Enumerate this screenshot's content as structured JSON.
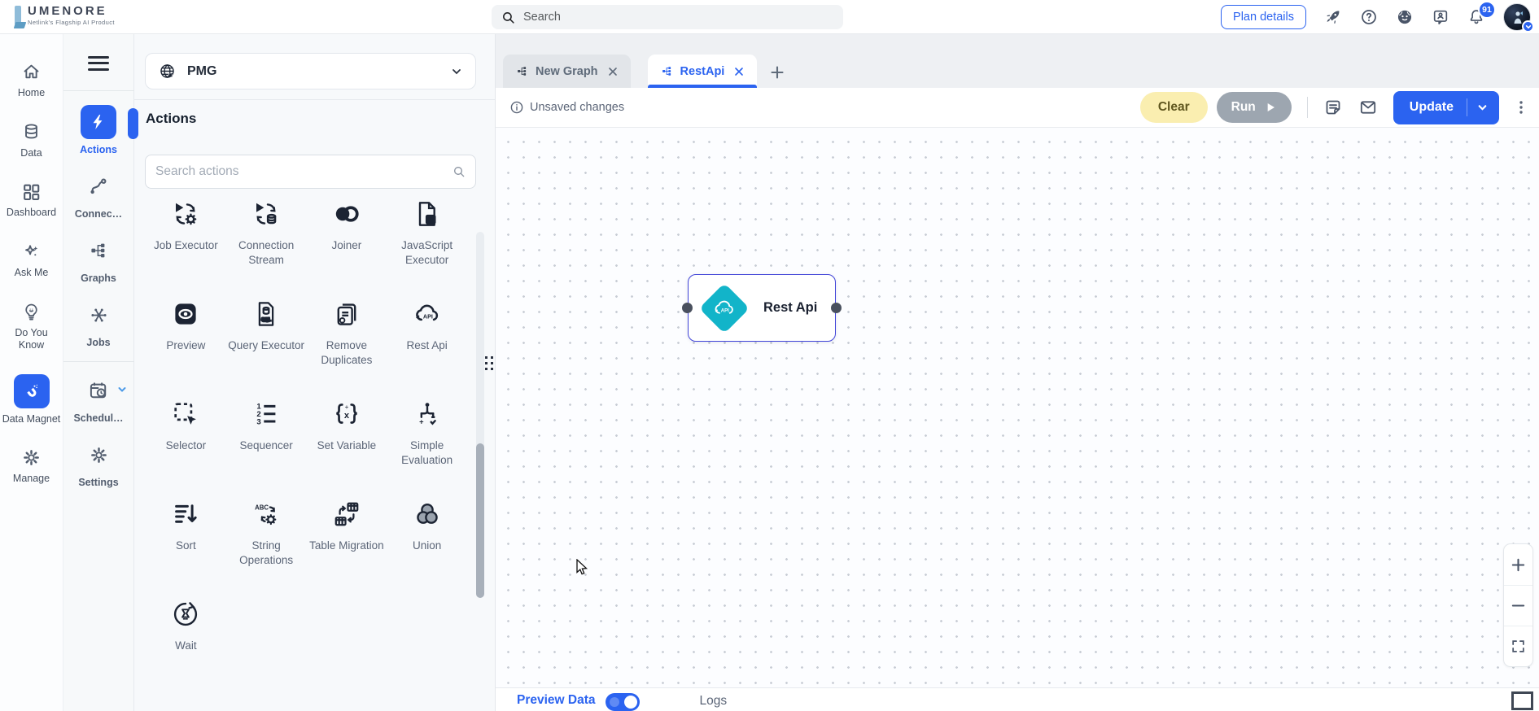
{
  "colors": {
    "accent_blue": "#2b63f0",
    "node_border": "#4144d8",
    "node_teal": "#12b4c9",
    "clear_yellow_bg": "#faeeb0",
    "run_gray_bg": "#9da6b0",
    "canvas_dot": "#c9ced6"
  },
  "header": {
    "brand": "UMENORE",
    "tagline": "Netlink's Flagship AI Product",
    "search_placeholder": "Search",
    "plan_details_label": "Plan details",
    "notification_count": "91"
  },
  "primary_nav": {
    "items": [
      {
        "label": "Home",
        "icon": "home-icon",
        "active": false
      },
      {
        "label": "Data",
        "icon": "data-icon",
        "active": false
      },
      {
        "label": "Dashboard",
        "icon": "dashboard-icon",
        "active": false
      },
      {
        "label": "Ask Me",
        "icon": "ask-me-icon",
        "active": false
      },
      {
        "label": "Do You Know",
        "icon": "do-you-know-icon",
        "active": false
      },
      {
        "label": "Data Magnet",
        "icon": "data-magnet-icon",
        "active": true
      },
      {
        "label": "Manage",
        "icon": "manage-icon",
        "active": false
      }
    ]
  },
  "secondary_nav": {
    "items": [
      {
        "label": "Actions",
        "icon": "actions-icon",
        "active": true
      },
      {
        "label": "Connec…",
        "icon": "connections-icon",
        "active": false
      },
      {
        "label": "Graphs",
        "icon": "graphs-icon",
        "active": false
      },
      {
        "label": "Jobs",
        "icon": "jobs-icon",
        "active": false
      },
      {
        "label": "Schedul…",
        "icon": "scheduler-icon",
        "active": false
      },
      {
        "label": "Settings",
        "icon": "settings-icon",
        "active": false
      }
    ]
  },
  "actions_panel": {
    "workspace": "PMG",
    "title": "Actions",
    "search_placeholder": "Search actions",
    "actions": [
      {
        "name": "Job Executor",
        "icon": "job-executor-icon"
      },
      {
        "name": "Connection Stream",
        "icon": "connection-stream-icon"
      },
      {
        "name": "Joiner",
        "icon": "joiner-icon"
      },
      {
        "name": "JavaScript Executor",
        "icon": "javascript-executor-icon"
      },
      {
        "name": "Preview",
        "icon": "preview-icon"
      },
      {
        "name": "Query Executor",
        "icon": "query-executor-icon"
      },
      {
        "name": "Remove Duplicates",
        "icon": "remove-duplicates-icon"
      },
      {
        "name": "Rest Api",
        "icon": "rest-api-icon"
      },
      {
        "name": "Selector",
        "icon": "selector-icon"
      },
      {
        "name": "Sequencer",
        "icon": "sequencer-icon"
      },
      {
        "name": "Set Variable",
        "icon": "set-variable-icon"
      },
      {
        "name": "Simple Evaluation",
        "icon": "simple-evaluation-icon"
      },
      {
        "name": "Sort",
        "icon": "sort-icon"
      },
      {
        "name": "String Operations",
        "icon": "string-operations-icon"
      },
      {
        "name": "Table Migration",
        "icon": "table-migration-icon"
      },
      {
        "name": "Union",
        "icon": "union-icon"
      },
      {
        "name": "Wait",
        "icon": "wait-icon"
      }
    ]
  },
  "tab_bar": {
    "tabs": [
      {
        "label": "New Graph",
        "active": false
      },
      {
        "label": "RestApi",
        "active": true
      }
    ]
  },
  "toolbar": {
    "status": "Unsaved changes",
    "clear_label": "Clear",
    "run_label": "Run",
    "update_label": "Update"
  },
  "canvas": {
    "node": {
      "label": "Rest Api"
    }
  },
  "bottom_bar": {
    "preview_label": "Preview Data",
    "preview_on": true,
    "logs_label": "Logs"
  }
}
